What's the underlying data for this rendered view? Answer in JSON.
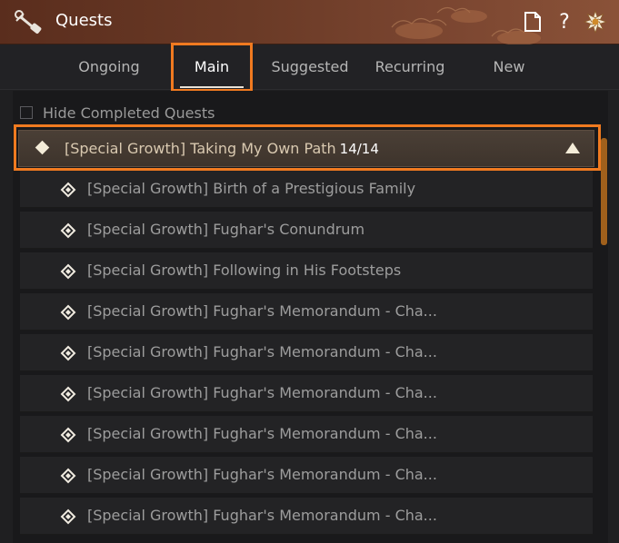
{
  "window": {
    "title": "Quests",
    "help_glyph": "?"
  },
  "tabs": [
    {
      "label": "Ongoing",
      "active": false
    },
    {
      "label": "Main",
      "active": true
    },
    {
      "label": "Suggested",
      "active": false
    },
    {
      "label": "Recurring",
      "active": false
    },
    {
      "label": "New",
      "active": false
    }
  ],
  "filter": {
    "hide_completed_label": "Hide Completed Quests",
    "hide_completed_checked": false
  },
  "group": {
    "title": "[Special Growth] Taking My Own Path",
    "progress": "14/14",
    "expanded": true
  },
  "quests": [
    {
      "label": "[Special Growth] Birth of a Prestigious Family"
    },
    {
      "label": "[Special Growth] Fughar's Conundrum"
    },
    {
      "label": "[Special Growth] Following in His Footsteps"
    },
    {
      "label": "[Special Growth] Fughar's Memorandum - Cha..."
    },
    {
      "label": "[Special Growth] Fughar's Memorandum - Cha..."
    },
    {
      "label": "[Special Growth] Fughar's Memorandum - Cha..."
    },
    {
      "label": "[Special Growth] Fughar's Memorandum - Cha..."
    },
    {
      "label": "[Special Growth] Fughar's Memorandum - Cha..."
    },
    {
      "label": "[Special Growth] Fughar's Memorandum - Cha..."
    }
  ],
  "icons": {
    "title": "scroll-icon",
    "doc": "document-icon",
    "help": "help-icon",
    "settings": "flower-icon",
    "group": "diamond-icon",
    "quest": "quest-diamond-icon",
    "collapse": "triangle-up-icon"
  },
  "colors": {
    "highlight": "#f07a20",
    "titlebar": "#6a3a26",
    "scroll_thumb": "#a0601c"
  }
}
